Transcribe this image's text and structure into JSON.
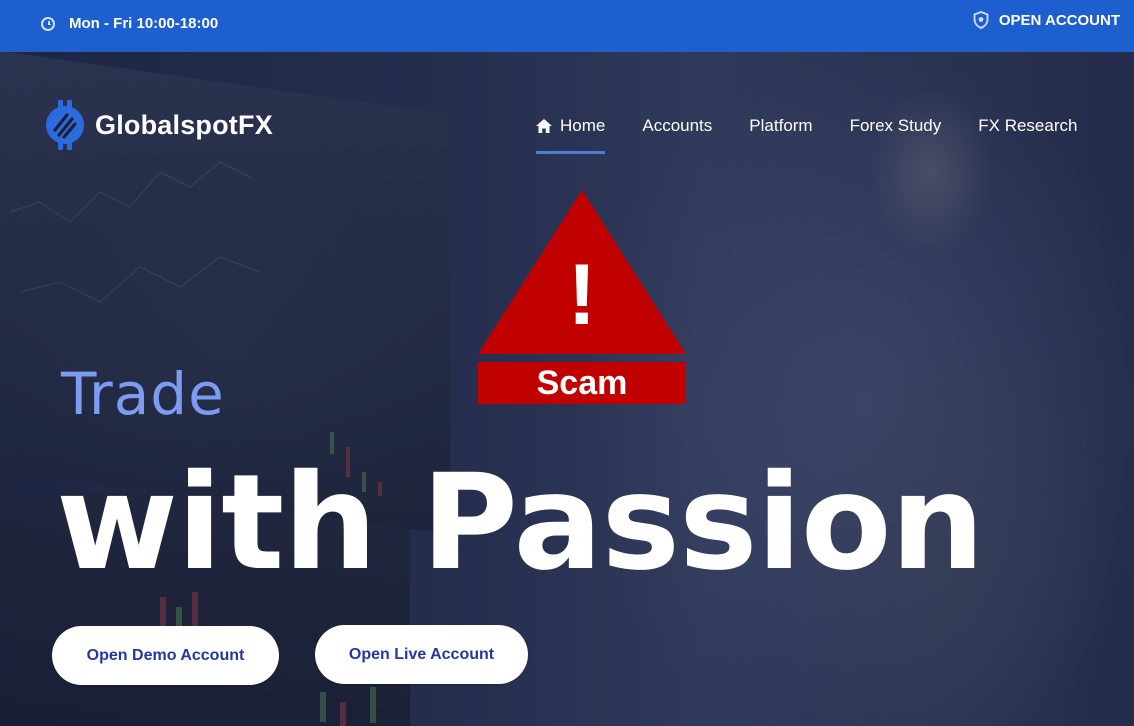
{
  "topbar": {
    "hours_text": "Mon - Fri 10:00-18:00",
    "open_account_label": "OPEN ACCOUNT"
  },
  "brand": {
    "name": "GlobalspotFX"
  },
  "nav": {
    "items": [
      {
        "label": "Home",
        "icon": "home-icon",
        "active": true
      },
      {
        "label": "Accounts"
      },
      {
        "label": "Platform"
      },
      {
        "label": "Forex Study"
      },
      {
        "label": "FX Research"
      }
    ]
  },
  "warning": {
    "symbol": "!",
    "label": "Scam"
  },
  "hero": {
    "line1": "Trade",
    "line2": "with Passion",
    "demo_button": "Open Demo Account",
    "live_button": "Open Live Account"
  },
  "colors": {
    "topbar_bg": "#1e5fcf",
    "accent": "#7b9cf0",
    "warning_red": "#c10000",
    "button_text": "#2438a0"
  }
}
